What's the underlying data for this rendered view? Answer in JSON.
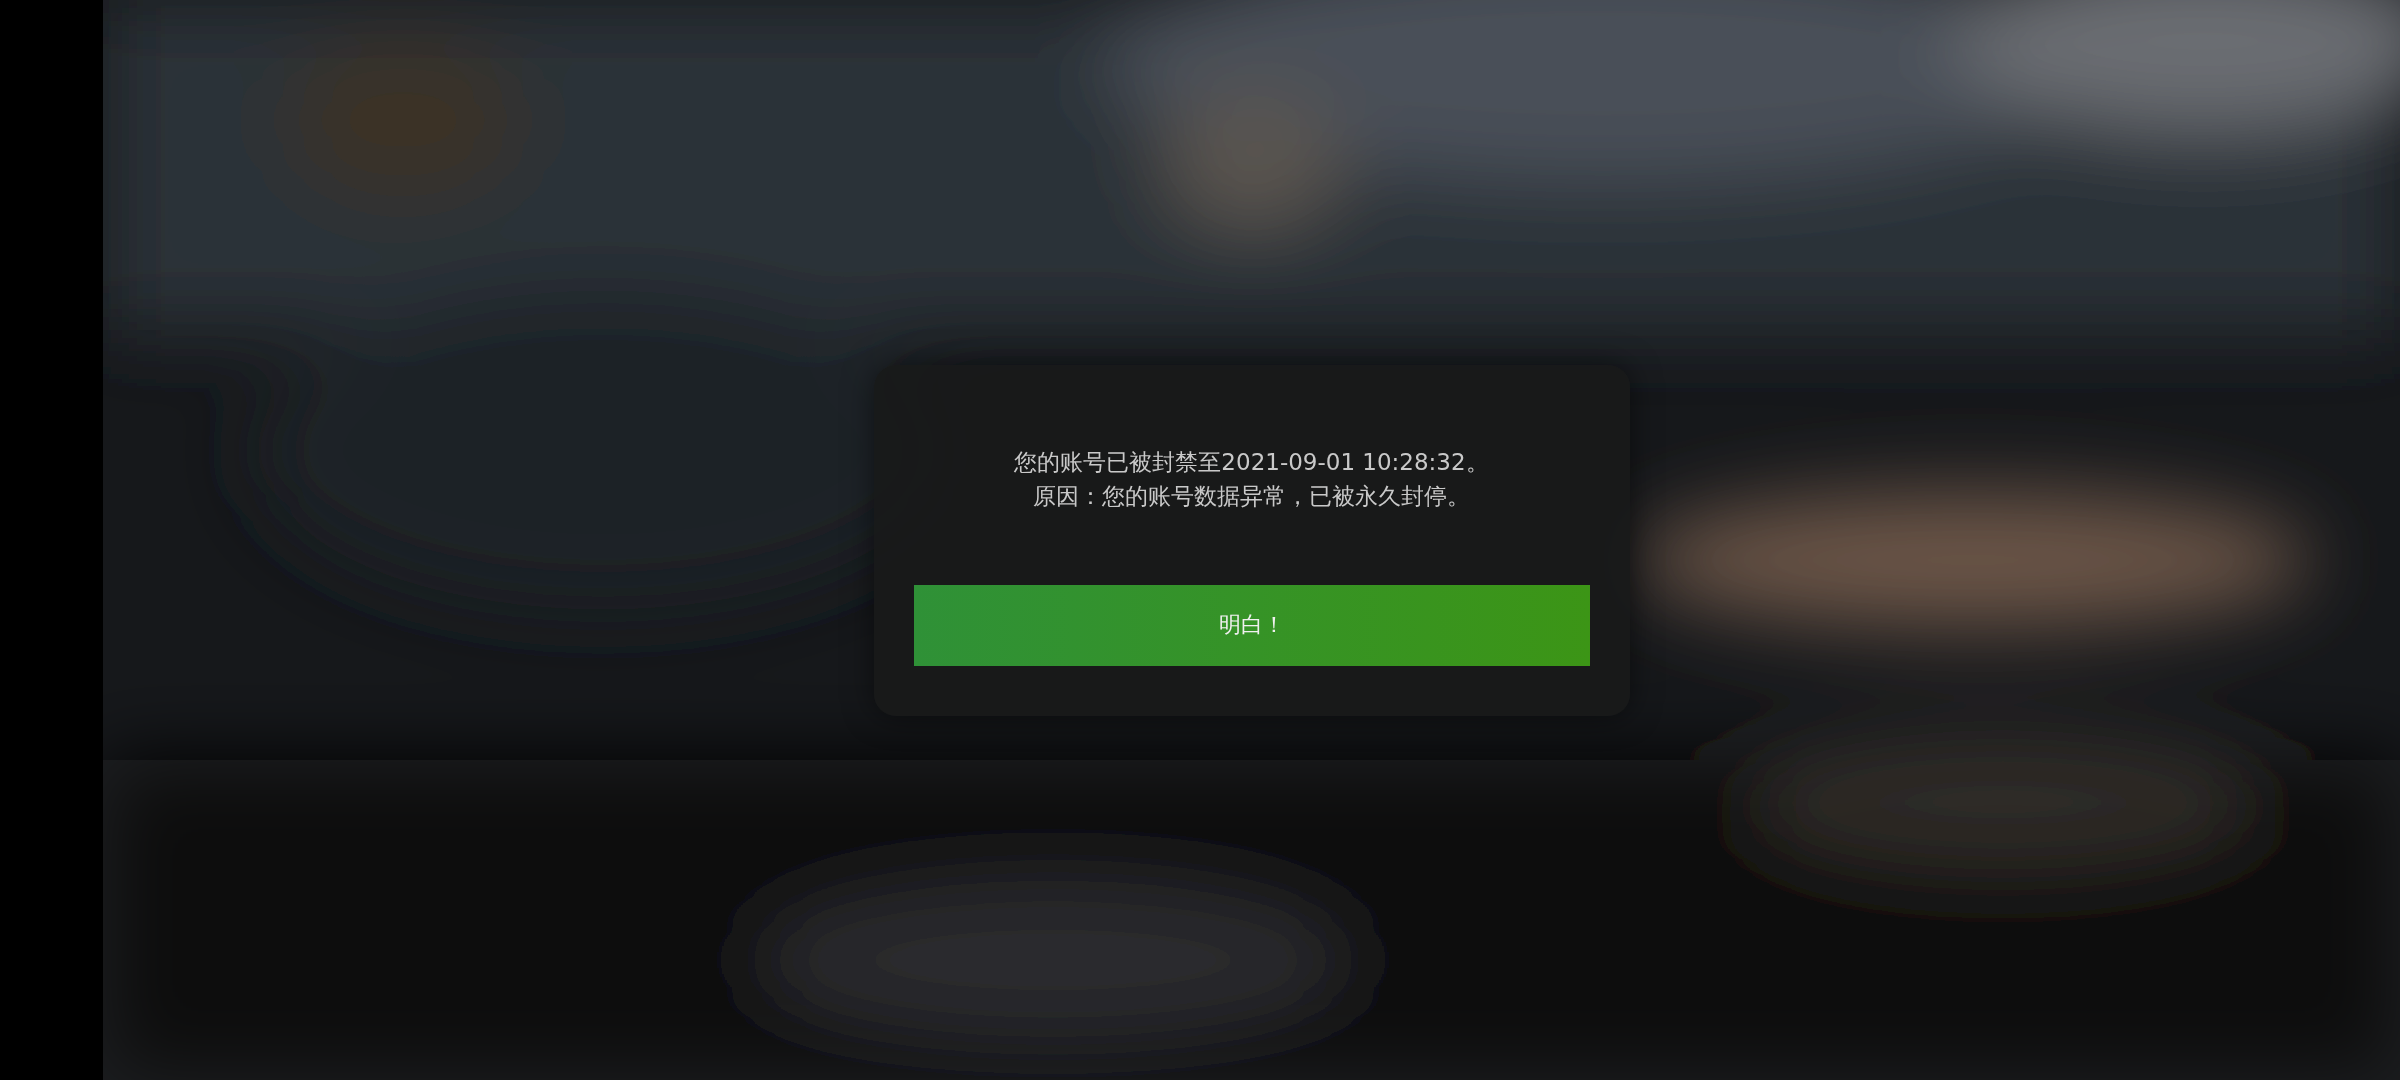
{
  "dialog": {
    "message_lines": [
      "您的账号已被封禁至2021-09-01 10:28:32。",
      "原因：您的账号数据异常，已被永久封停。"
    ],
    "button": "明白！"
  }
}
